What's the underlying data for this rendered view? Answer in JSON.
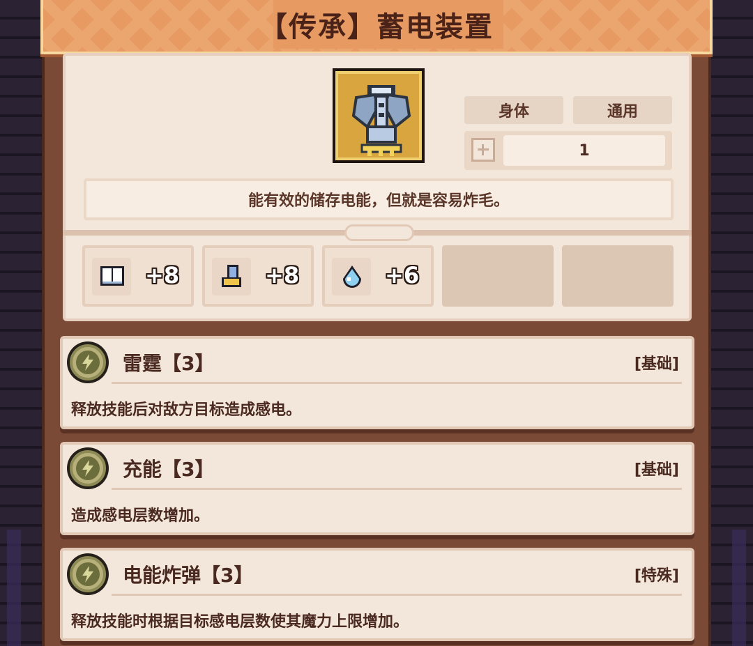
{
  "title": "【传承】蓄电装置",
  "item": {
    "icon": "shoulder-armor-icon",
    "tags": [
      "身体",
      "通用"
    ],
    "stack_count": "1",
    "description": "能有效的储存电能，但就是容易炸毛。"
  },
  "stats": [
    {
      "icon": "book-icon",
      "value": "+8"
    },
    {
      "icon": "boot-icon",
      "value": "+8"
    },
    {
      "icon": "water-drop-icon",
      "value": "+6"
    }
  ],
  "skills": [
    {
      "name": "雷霆【3】",
      "kind": "[基础]",
      "effect": "释放技能后对敌方目标造成感电。"
    },
    {
      "name": "充能【3】",
      "kind": "[基础]",
      "effect": "造成感电层数增加。"
    },
    {
      "name": "电能炸弹【3】",
      "kind": "[特殊]",
      "effect": "释放技能时根据目标感电层数使其魔力上限增加。"
    }
  ],
  "colors": {
    "title_bg": "#e79b63",
    "card_bg": "#f3e6da",
    "text": "#4a2a20",
    "item_frame": "#d9a53e"
  }
}
